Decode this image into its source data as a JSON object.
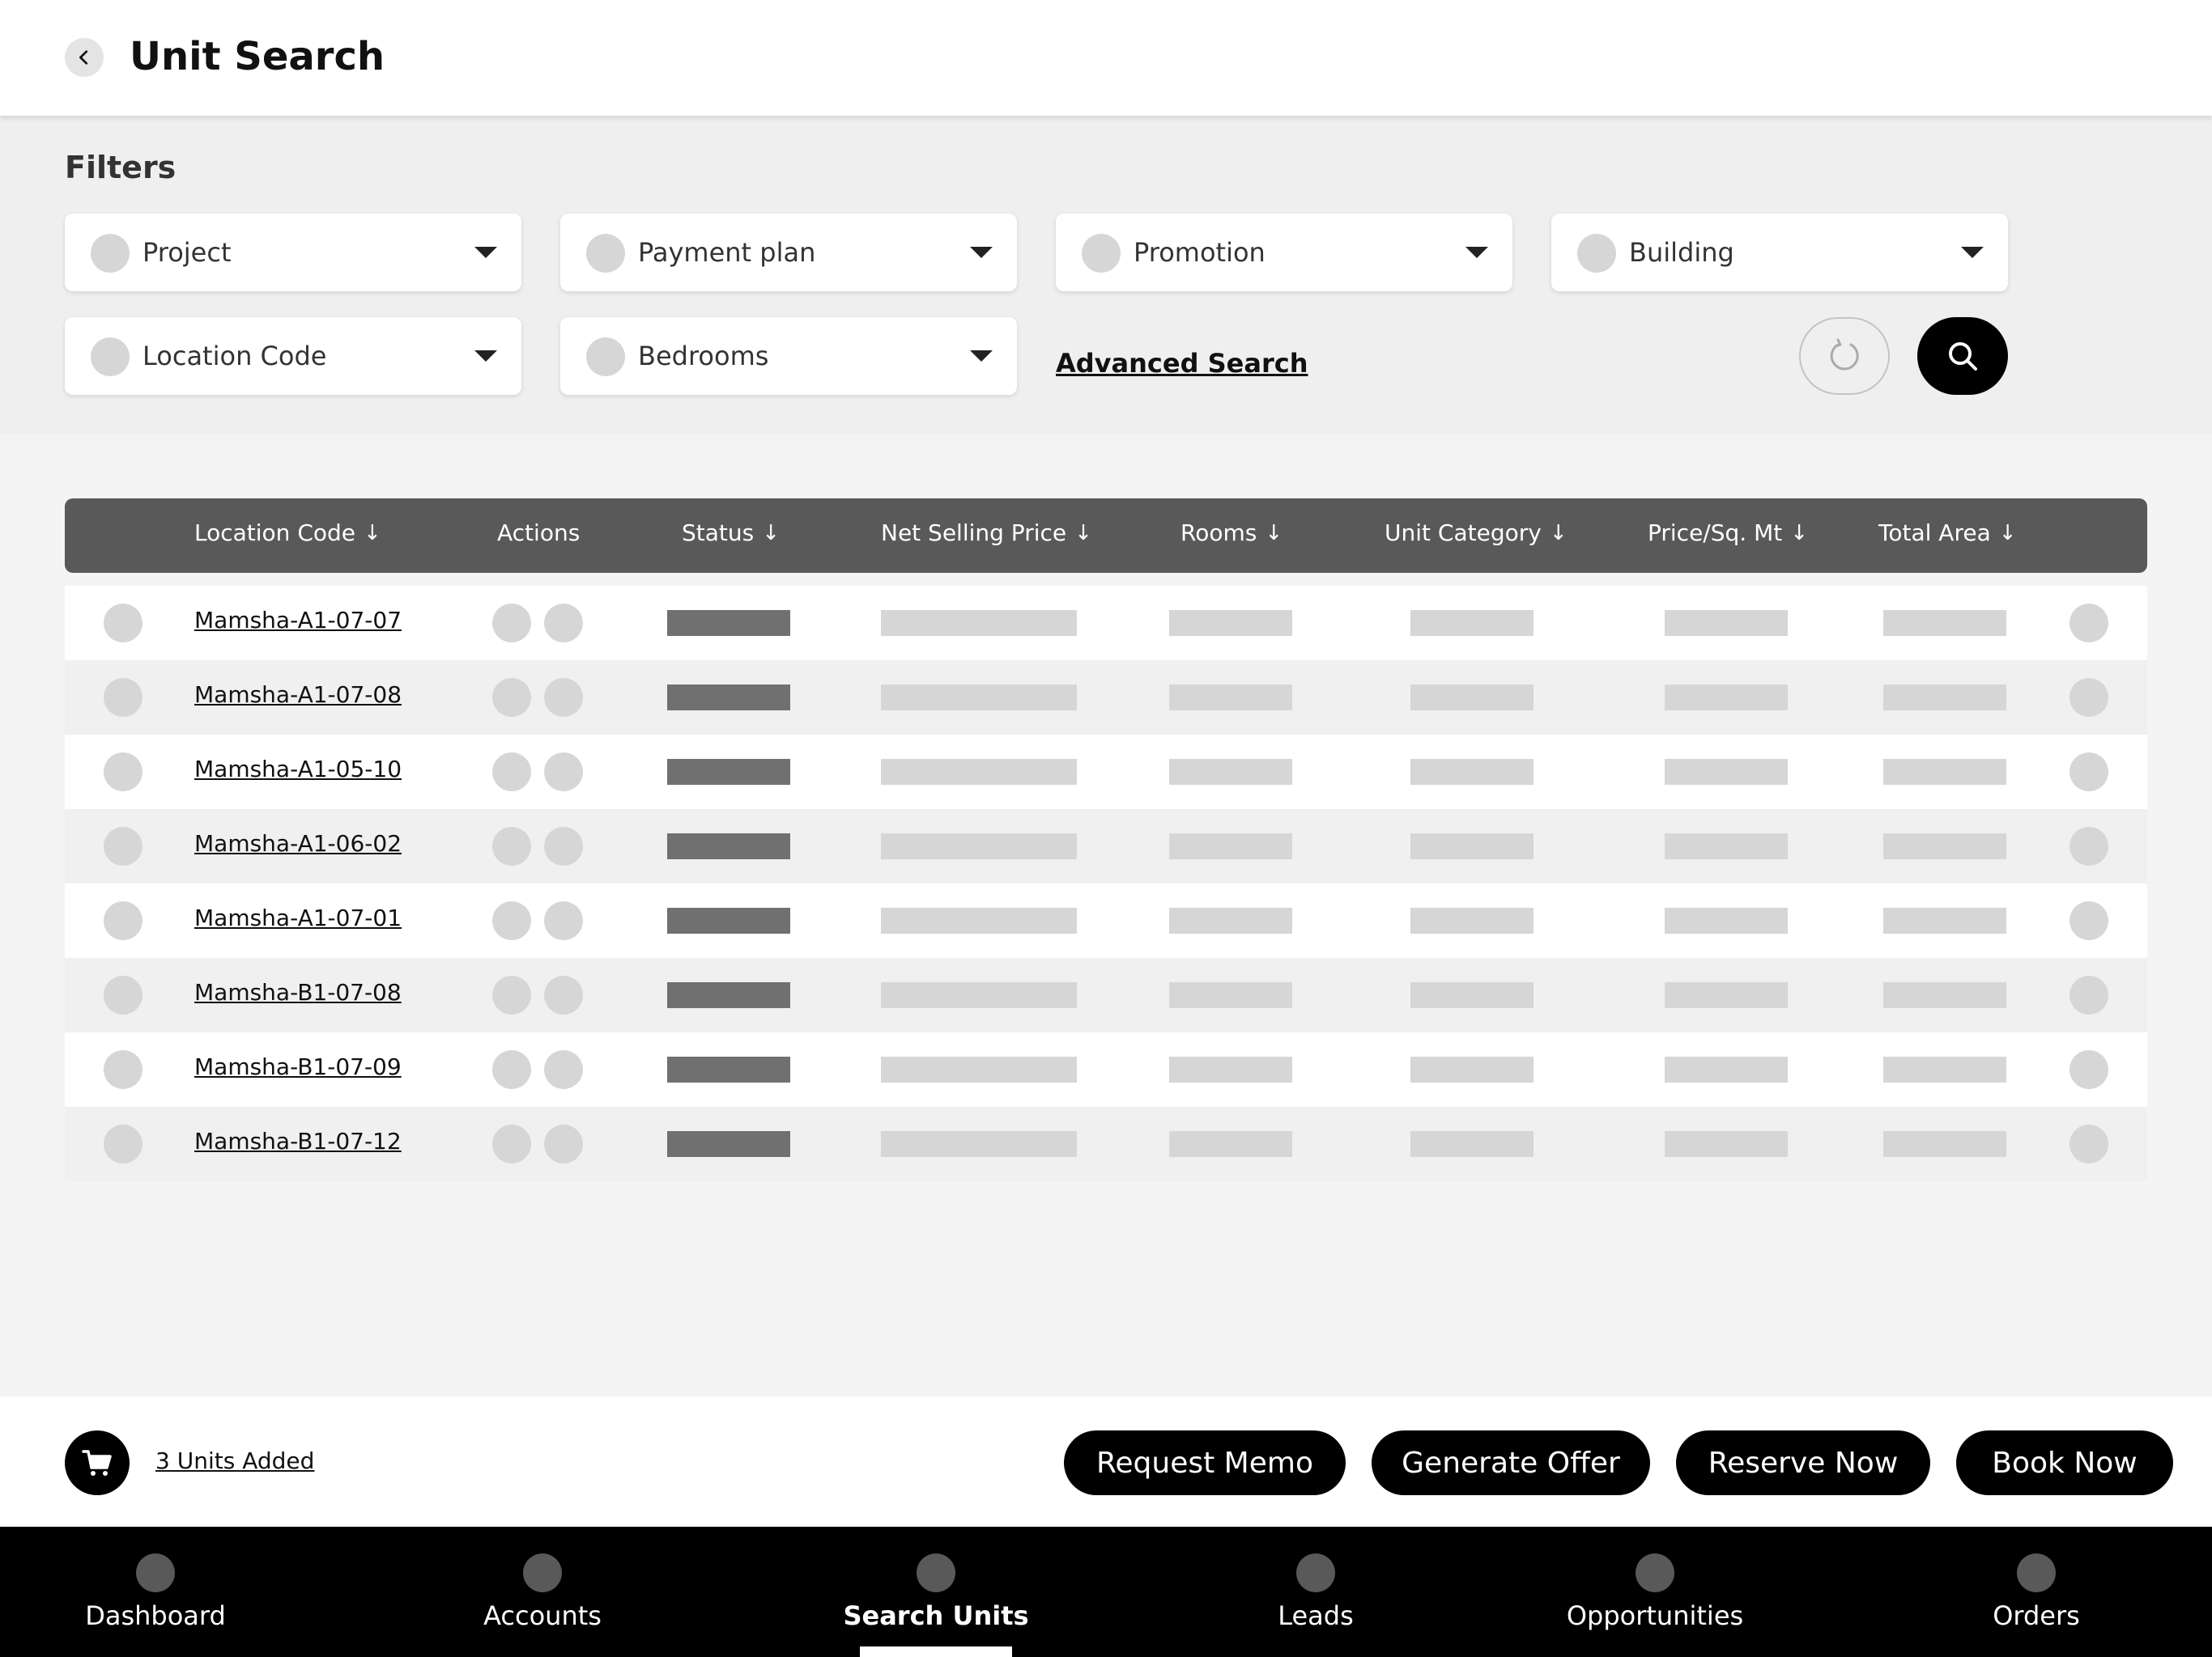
{
  "header": {
    "title": "Unit Search"
  },
  "filters": {
    "title": "Filters",
    "dropdowns": [
      {
        "label": "Project"
      },
      {
        "label": "Payment plan"
      },
      {
        "label": "Promotion"
      },
      {
        "label": "Building"
      },
      {
        "label": "Location Code"
      },
      {
        "label": "Bedrooms"
      }
    ],
    "advanced_search": "Advanced Search"
  },
  "table": {
    "columns": [
      {
        "label": "Location Code",
        "sortable": true
      },
      {
        "label": "Actions",
        "sortable": false
      },
      {
        "label": "Status",
        "sortable": true
      },
      {
        "label": "Net Selling Price",
        "sortable": true
      },
      {
        "label": "Rooms",
        "sortable": true
      },
      {
        "label": "Unit Category",
        "sortable": true
      },
      {
        "label": "Price/Sq. Mt",
        "sortable": true
      },
      {
        "label": "Total Area",
        "sortable": true
      }
    ],
    "sort_arrow": "↓",
    "rows": [
      {
        "location_code": "Mamsha-A1-07-07"
      },
      {
        "location_code": "Mamsha-A1-07-08"
      },
      {
        "location_code": "Mamsha-A1-05-10"
      },
      {
        "location_code": "Mamsha-A1-06-02"
      },
      {
        "location_code": "Mamsha-A1-07-01"
      },
      {
        "location_code": "Mamsha-B1-07-08"
      },
      {
        "location_code": "Mamsha-B1-07-09"
      },
      {
        "location_code": "Mamsha-B1-07-12"
      }
    ]
  },
  "action_bar": {
    "units_added": "3 Units Added",
    "buttons": [
      {
        "label": "Request Memo"
      },
      {
        "label": "Generate Offer"
      },
      {
        "label": "Reserve Now"
      },
      {
        "label": "Book Now"
      }
    ]
  },
  "bottom_nav": {
    "items": [
      {
        "label": "Dashboard"
      },
      {
        "label": "Accounts"
      },
      {
        "label": "Search Units"
      },
      {
        "label": "Leads"
      },
      {
        "label": "Opportunities"
      },
      {
        "label": "Orders"
      }
    ],
    "active": "Search Units"
  },
  "colors": {
    "header_bg": "#ffffff",
    "filters_bg": "#efefef",
    "table_header_bg": "#595959",
    "status_bar": "#707070",
    "placeholder": "#d6d6d6",
    "primary_button": "#000000",
    "nav_bg": "#000000"
  },
  "icons": {
    "back": "chevron-left-icon",
    "reset": "refresh-icon",
    "search": "search-icon",
    "cart": "cart-icon",
    "dropdown": "caret-down-icon"
  }
}
